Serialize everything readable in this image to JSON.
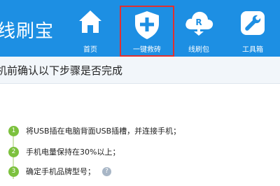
{
  "header": {
    "app_title": "线刷宝",
    "nav": [
      {
        "label": "首页",
        "icon": "home-icon"
      },
      {
        "label": "一键救砖",
        "icon": "shield-plus-icon"
      },
      {
        "label": "线刷包",
        "icon": "cloud-download-icon"
      },
      {
        "label": "工具箱",
        "icon": "wrench-icon"
      }
    ]
  },
  "subbar": {
    "text": "机前确认以下步骤是否完成"
  },
  "steps": [
    {
      "num": "1",
      "text": "将USB插在电脑背面USB插槽，并连接手机；"
    },
    {
      "num": "2",
      "text": "手机电量保持在30%以上；"
    },
    {
      "num": "3",
      "text": "确定手机品牌型号；",
      "help": "?"
    }
  ],
  "colors": {
    "header_bg": "#1d8fe3",
    "highlight_border": "#e03030",
    "step_green": "#7cc13d"
  }
}
